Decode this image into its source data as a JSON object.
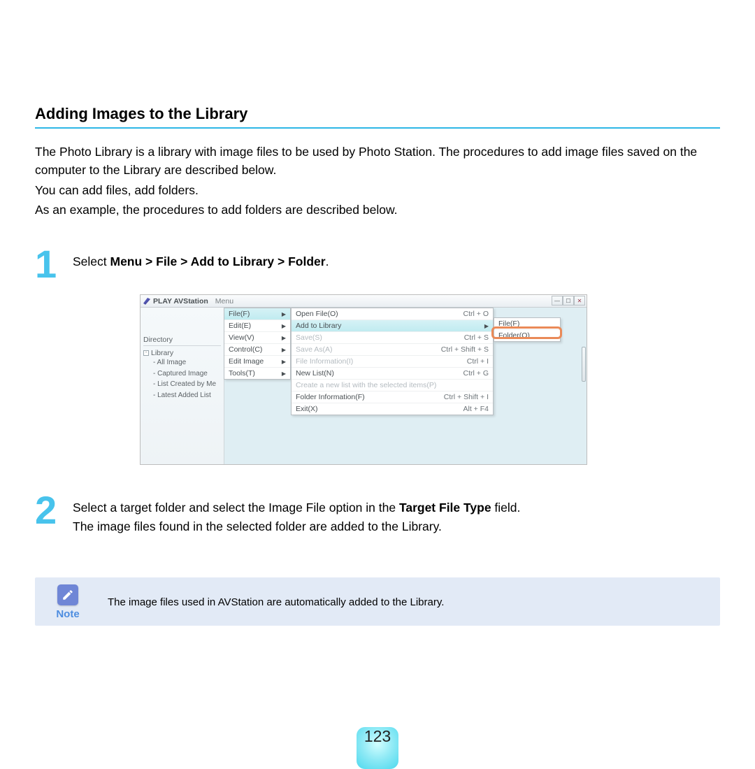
{
  "section_title": "Adding Images to the Library",
  "intro": {
    "p1": "The Photo Library is a library with image files to be used by Photo Station. The procedures to add image files saved on the computer to the Library are described below.",
    "p2": "You can add files, add folders.",
    "p3": "As an example, the procedures to add folders are described below."
  },
  "step1": {
    "num": "1",
    "text_prefix": "Select ",
    "bold": "Menu > File > Add to Library > Folder",
    "text_suffix": "."
  },
  "step2": {
    "num": "2",
    "line1_a": "Select a target folder and select the Image File option in the ",
    "line1_bold": "Target File Type",
    "line1_b": " field.",
    "line2": "The image files found in the selected folder are added to the Library."
  },
  "note": {
    "label": "Note",
    "text": "The image files used in AVStation are automatically added to the Library."
  },
  "screenshot": {
    "app_title": "PLAY AVStation",
    "menu_label": "Menu",
    "sidebar": {
      "directory": "Directory",
      "root": "Library",
      "items": [
        "- All Image",
        "- Captured Image",
        "- List Created by Me",
        "- Latest Added List"
      ]
    },
    "menu1": [
      {
        "label": "File(F)",
        "sel": true
      },
      {
        "label": "Edit(E)"
      },
      {
        "label": "View(V)"
      },
      {
        "label": "Control(C)"
      },
      {
        "label": "Edit Image"
      },
      {
        "label": "Tools(T)"
      }
    ],
    "menu2": [
      {
        "label": "Open File(O)",
        "sc": "Ctrl + O"
      },
      {
        "label": "Add to Library",
        "sel": true,
        "arrow": true
      },
      {
        "label": "Save(S)",
        "sc": "Ctrl + S",
        "disabled": true
      },
      {
        "label": "Save As(A)",
        "sc": "Ctrl + Shift + S",
        "disabled": true
      },
      {
        "label": "File Information(I)",
        "sc": "Ctrl + I",
        "disabled": true
      },
      {
        "label": "New List(N)",
        "sc": "Ctrl + G"
      },
      {
        "label": "Create a new list with the selected items(P)",
        "disabled": true
      },
      {
        "label": "Folder Information(F)",
        "sc": "Ctrl + Shift + I"
      },
      {
        "label": "Exit(X)",
        "sc": "Alt + F4"
      }
    ],
    "menu3": [
      {
        "label": "File(F)"
      },
      {
        "label": "Folder(O)",
        "hilite": true
      }
    ]
  },
  "page_number": "123"
}
